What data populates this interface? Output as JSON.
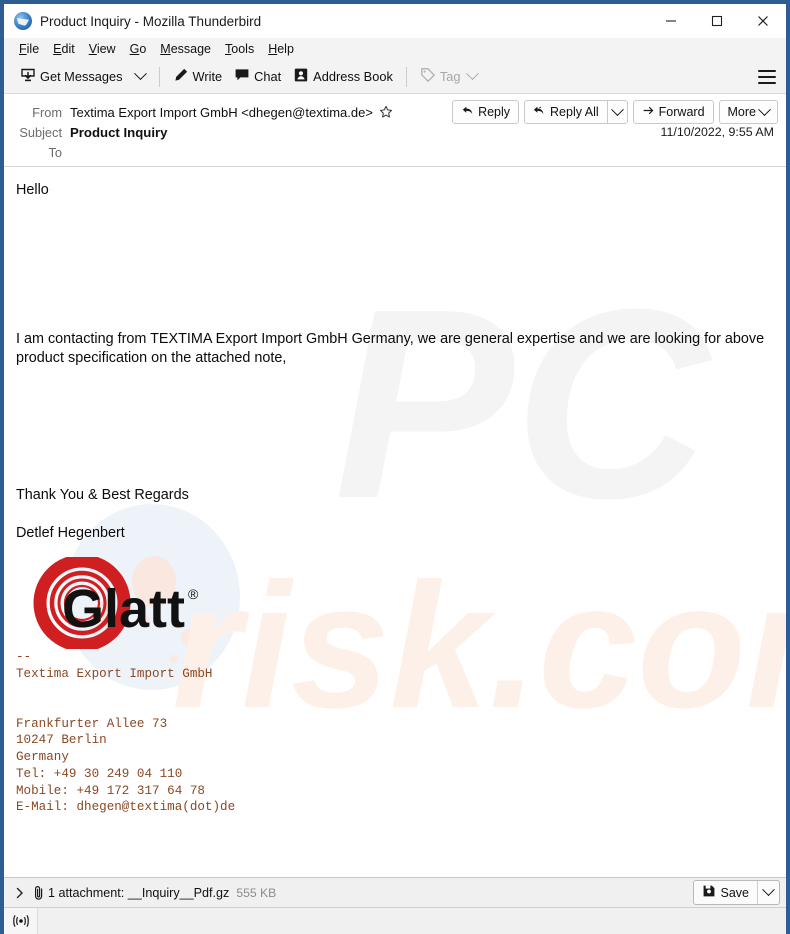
{
  "window": {
    "title": "Product Inquiry - Mozilla Thunderbird",
    "app_icon": "thunderbird-icon",
    "minimize_label": "Minimize",
    "maximize_label": "Maximize",
    "close_label": "Close"
  },
  "menubar": {
    "items": [
      {
        "label": "File",
        "accel": "F"
      },
      {
        "label": "Edit",
        "accel": "E"
      },
      {
        "label": "View",
        "accel": "V"
      },
      {
        "label": "Go",
        "accel": "G"
      },
      {
        "label": "Message",
        "accel": "M"
      },
      {
        "label": "Tools",
        "accel": "T"
      },
      {
        "label": "Help",
        "accel": "H"
      }
    ]
  },
  "toolbar": {
    "get_messages": "Get Messages",
    "write": "Write",
    "chat": "Chat",
    "address_book": "Address Book",
    "tag": "Tag",
    "app_menu": "Application Menu"
  },
  "header": {
    "from_label": "From",
    "from_value": "Textima Export Import GmbH <dhegen@textima.de>",
    "subject_label": "Subject",
    "subject_value": "Product Inquiry",
    "to_label": "To",
    "to_value": "",
    "date": "11/10/2022, 9:55 AM",
    "star_icon": "star-icon",
    "actions": {
      "reply": "Reply",
      "reply_all": "Reply All",
      "forward": "Forward",
      "more": "More"
    }
  },
  "body": {
    "greeting": "Hello",
    "paragraph": "I am contacting from TEXTIMA Export Import GmbH Germany, we are general expertise and we are looking for above product specification on  the attached note,",
    "closing": "Thank You & Best Regards",
    "sender_name": "Detlef  Hegenbert",
    "logo_text": "Glatt",
    "logo_trademark": "®",
    "signature": "--\nTextima Export Import GmbH\n\n\nFrankfurter Allee 73\n10247 Berlin\nGermany\nTel: +49 30 249 04 110\nMobile: +49 172 317 64 78\nE-Mail: dhegen@textima(dot)de",
    "watermark_text": "PCrisk.com"
  },
  "attachment": {
    "expand_icon": "chevron-right-icon",
    "paperclip_icon": "paperclip-icon",
    "summary": "1 attachment: __Inquiry__Pdf.gz",
    "size": "555 KB",
    "save_label": "Save"
  },
  "status": {
    "icon": "broadcast-icon",
    "text": ""
  },
  "colors": {
    "window_border": "#2f5c92",
    "signature_text": "#8a4824",
    "logo_red": "#cf1f21",
    "accent": "#2f5c92"
  }
}
